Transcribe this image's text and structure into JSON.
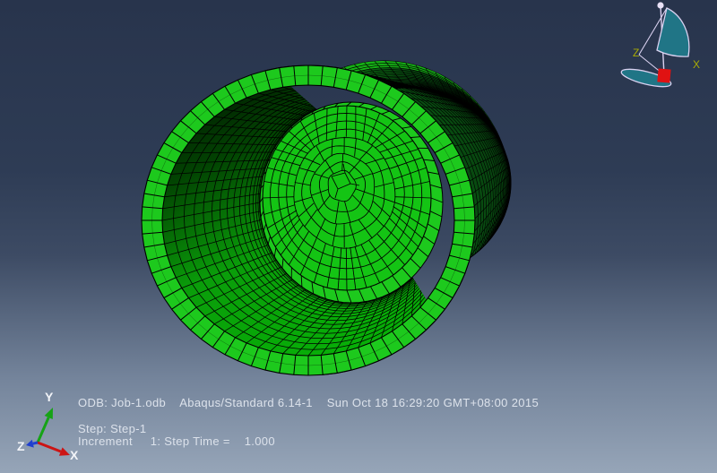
{
  "viewport": {
    "status": {
      "odb_line": "ODB: Job-1.odb    Abaqus/Standard 6.14-1    Sun Oct 18 16:29:20 GMT+08:00 2015",
      "step_line": "Step: Step-1",
      "increment_line": "Increment     1: Step Time =    1.000"
    },
    "origin_triad": {
      "x_label": "X",
      "y_label": "Y",
      "z_label": "Z"
    },
    "view_compass": {
      "x_label": "X",
      "z_label": "Z"
    },
    "colors": {
      "bg_top": "#28344c",
      "bg_mid": "#3d4b64",
      "bg_bottom": "#96a5b8",
      "mesh_bright": "#1dc91d",
      "mesh_mid": "#0a9d0a",
      "mesh_dark": "#06380c",
      "element_edge": "#000000",
      "axis_x": "#cc1414",
      "axis_y": "#16a316",
      "axis_z": "#1f3fd0",
      "compass_teal": "#207586",
      "compass_outline": "#d9d1f0",
      "compass_marker": "#e01212",
      "compass_label": "#a9ab04",
      "status_text": "#dce2eb",
      "triad_label": "#f2f4f8"
    }
  }
}
